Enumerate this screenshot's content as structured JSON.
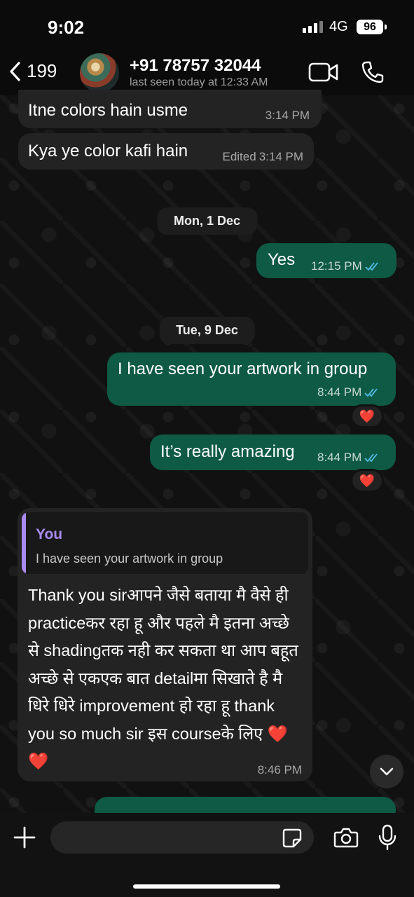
{
  "status_bar": {
    "time": "9:02",
    "network": "4G",
    "battery": "96"
  },
  "header": {
    "back_count": "199",
    "contact_name": "+91 78757 32044",
    "last_seen": "last seen today at 12:33 AM"
  },
  "messages": [
    {
      "text": "Itne colors hain usme",
      "time": "3:14 PM"
    },
    {
      "text": "Kya ye color kafi hain",
      "edited": "Edited",
      "time": "3:14 PM"
    },
    {
      "text": "Yes",
      "time": "12:15 PM"
    },
    {
      "text": "I have seen your artwork in group",
      "time": "8:44 PM",
      "reaction": "❤️"
    },
    {
      "text": "It’s really amazing",
      "time": "8:44 PM",
      "reaction": "❤️"
    },
    {
      "quote_author": "You",
      "quote_text": "I have seen your artwork in group",
      "text": "Thank you sirआपने जैसे बताया मै वैसे ही practiceकर रहा हू और पहले मै इतना अच्छे से shadingतक नही कर सकता था आप बहूत अच्छे से एकएक बात detailमा सिखाते है मै धिरे धिरे improvement हो रहा हू thank you so much sir इस courseके लिए ❤️ ❤️",
      "time": "8:46 PM"
    }
  ],
  "day_separators": {
    "first": "Mon, 1 Dec",
    "second": "Tue, 9 Dec"
  },
  "composer": {
    "placeholder": ""
  },
  "colors": {
    "outgoing_bubble": "#0e5a44",
    "incoming_bubble": "#232323",
    "quote_accent": "#a98bf0",
    "read_ticks": "#53bdeb"
  },
  "icons": [
    "back-chevron-icon",
    "video-call-icon",
    "phone-icon",
    "plus-icon",
    "sticker-icon",
    "camera-icon",
    "mic-icon",
    "chevron-down-icon",
    "double-check-icon"
  ]
}
